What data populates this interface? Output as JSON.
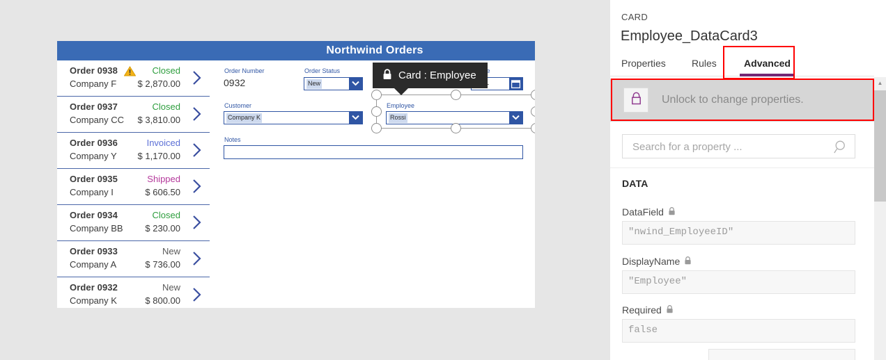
{
  "app": {
    "gallery_header_color": "#3a6bb5",
    "form_title": "Northwind Orders",
    "orders": [
      {
        "order": "Order 0938",
        "company": "Company F",
        "status": "Closed",
        "status_color": "#2e9e3e",
        "amount": "$ 2,870.00",
        "warning": true,
        "warning_icon": "warning-triangle-icon"
      },
      {
        "order": "Order 0937",
        "company": "Company CC",
        "status": "Closed",
        "status_color": "#2e9e3e",
        "amount": "$ 3,810.00",
        "warning": false,
        "warning_icon": ""
      },
      {
        "order": "Order 0936",
        "company": "Company Y",
        "status": "Invoiced",
        "status_color": "#5b6fd6",
        "amount": "$ 1,170.00",
        "warning": false,
        "warning_icon": ""
      },
      {
        "order": "Order 0935",
        "company": "Company I",
        "status": "Shipped",
        "status_color": "#b4399b",
        "amount": "$ 606.50",
        "warning": false,
        "warning_icon": ""
      },
      {
        "order": "Order 0934",
        "company": "Company BB",
        "status": "Closed",
        "status_color": "#2e9e3e",
        "amount": "$ 230.00",
        "warning": false,
        "warning_icon": ""
      },
      {
        "order": "Order 0933",
        "company": "Company A",
        "status": "New",
        "status_color": "#595959",
        "amount": "$ 736.00",
        "warning": false,
        "warning_icon": ""
      },
      {
        "order": "Order 0932",
        "company": "Company K",
        "status": "New",
        "status_color": "#595959",
        "amount": "$ 800.00",
        "warning": false,
        "warning_icon": ""
      }
    ],
    "form": {
      "order_number_label": "Order Number",
      "order_number_value": "0932",
      "order_status_label": "Order Status",
      "order_status_value": "New",
      "date_label": "te",
      "date_value": "2001",
      "customer_label": "Customer",
      "customer_value": "Company K",
      "employee_label": "Employee",
      "employee_value": "Rossi",
      "notes_label": "Notes",
      "notes_value": ""
    },
    "tooltip": {
      "text": "Card : Employee",
      "icon": "lock-icon"
    }
  },
  "panel": {
    "kind": "CARD",
    "title": "Employee_DataCard3",
    "tabs": [
      {
        "label": "Properties",
        "active": false
      },
      {
        "label": "Rules",
        "active": false
      },
      {
        "label": "Advanced",
        "active": true
      }
    ],
    "accent_color": "#742774",
    "unlock": {
      "icon": "lock-icon",
      "text": "Unlock to change properties."
    },
    "search": {
      "placeholder": "Search for a property ...",
      "value": "",
      "icon": "search-icon"
    },
    "data_section": {
      "title": "DATA",
      "properties": [
        {
          "label": "DataField",
          "lock_icon": "lock-icon",
          "value": "\"nwind_EmployeeID\""
        },
        {
          "label": "DisplayName",
          "lock_icon": "lock-icon",
          "value": "\"Employee\""
        },
        {
          "label": "Required",
          "lock_icon": "lock-icon",
          "value": "false"
        }
      ]
    },
    "scrollbar": {
      "up_arrow": "chevron-up-icon"
    }
  },
  "annotations": {
    "highlight_color": "#ff0000",
    "boxes": [
      "advanced-tab",
      "unlock-banner"
    ]
  }
}
